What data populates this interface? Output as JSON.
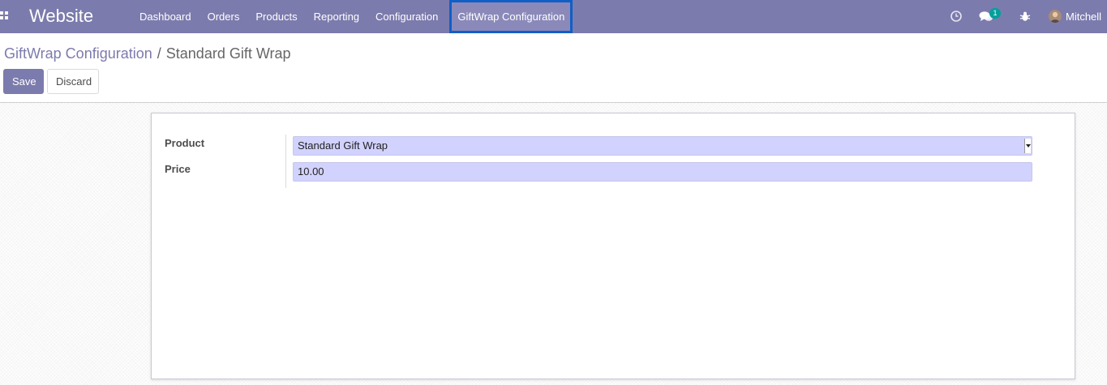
{
  "navbar": {
    "app_title": "Website",
    "menu": [
      "Dashboard",
      "Orders",
      "Products",
      "Reporting",
      "Configuration"
    ],
    "active_menu": "GiftWrap Configuration",
    "notification_count": "1",
    "user_name": "Mitchell",
    "accent_color": "#7c7bad",
    "highlight_color": "#0f5fc7"
  },
  "breadcrumb": {
    "parent": "GiftWrap Configuration",
    "separator": "/",
    "current": "Standard Gift Wrap"
  },
  "actions": {
    "save_label": "Save",
    "discard_label": "Discard"
  },
  "form": {
    "product_label": "Product",
    "product_value": "Standard Gift Wrap",
    "price_label": "Price",
    "price_value": "10.00"
  },
  "icons": [
    "apps-icon",
    "clock-icon",
    "chat-icon",
    "bug-icon",
    "avatar",
    "chevron-down-icon"
  ]
}
